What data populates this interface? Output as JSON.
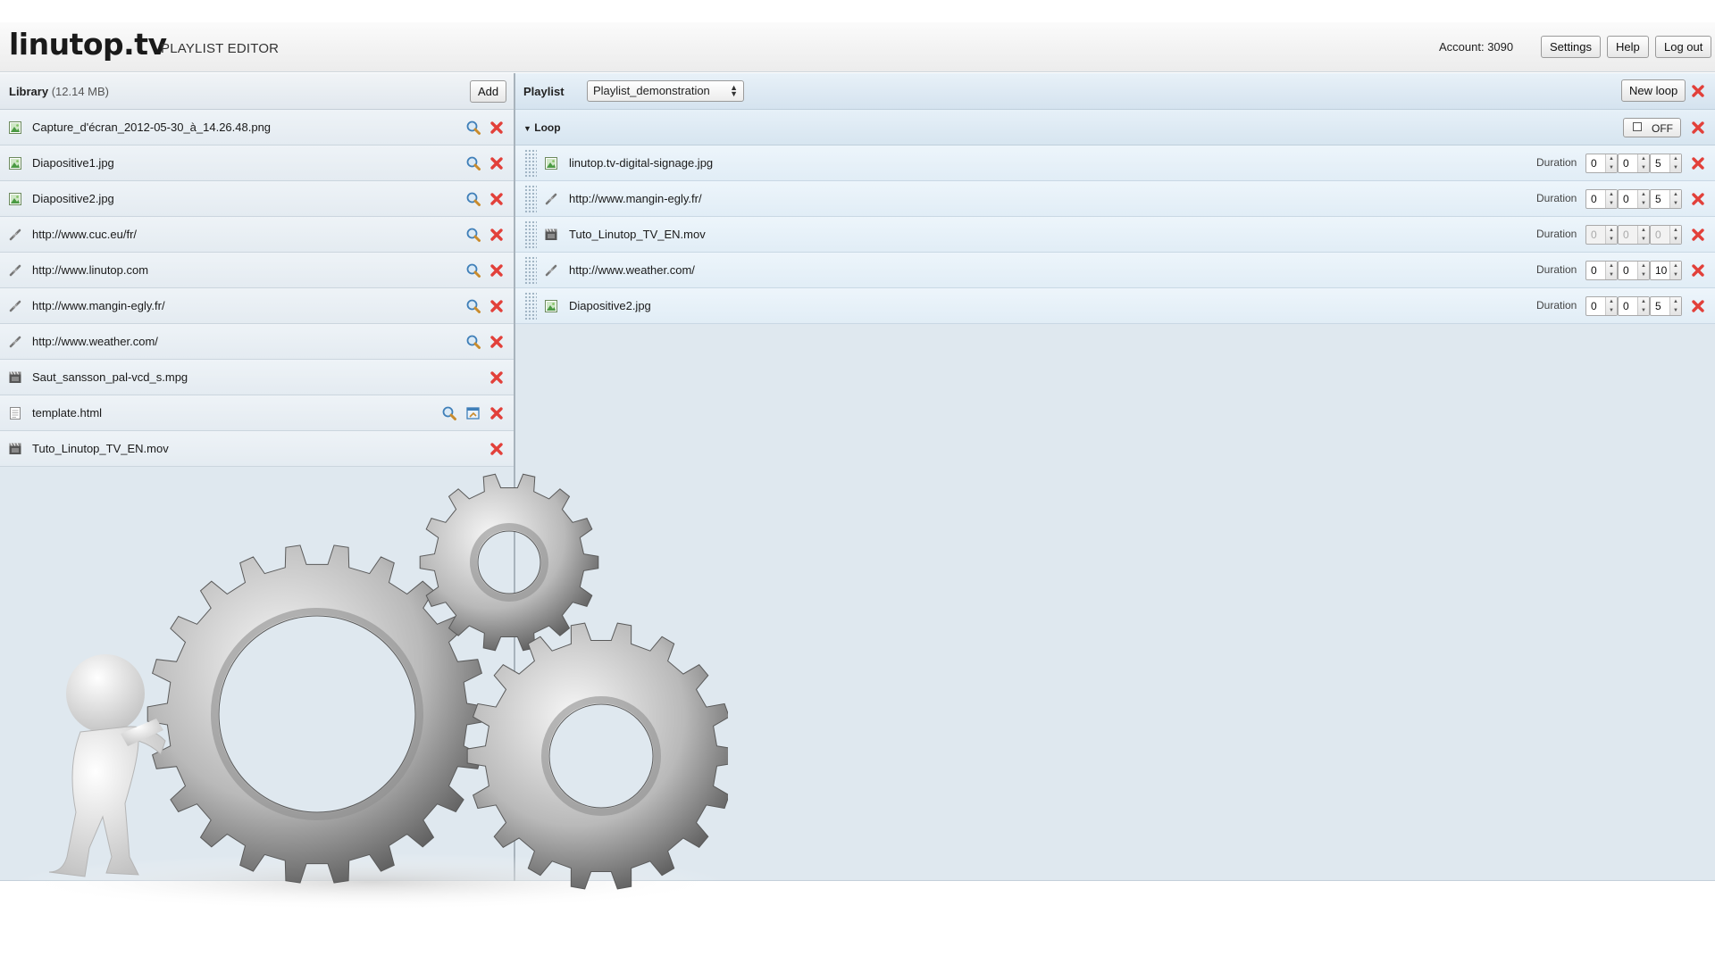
{
  "header": {
    "logo": "linutop.tv",
    "app_title": "PLAYLIST EDITOR",
    "account": "Account: 3090",
    "settings_label": "Settings",
    "help_label": "Help",
    "logout_label": "Log out"
  },
  "library": {
    "title": "Library",
    "size": "(12.14 MB)",
    "add_label": "Add",
    "items": [
      {
        "name": "Capture_d'écran_2012-05-30_à_14.26.48.png",
        "type": "image-icon"
      },
      {
        "name": "Diapositive1.jpg",
        "type": "image-icon"
      },
      {
        "name": "Diapositive2.jpg",
        "type": "image-icon"
      },
      {
        "name": "http://www.cuc.eu/fr/",
        "type": "link-icon"
      },
      {
        "name": "http://www.linutop.com",
        "type": "link-icon"
      },
      {
        "name": "http://www.mangin-egly.fr/",
        "type": "link-icon"
      },
      {
        "name": "http://www.weather.com/",
        "type": "link-icon"
      },
      {
        "name": "Saut_sansson_pal-vcd_s.mpg",
        "type": "video-icon"
      },
      {
        "name": "template.html",
        "type": "html-icon"
      },
      {
        "name": "Tuto_Linutop_TV_EN.mov",
        "type": "video-icon"
      }
    ]
  },
  "playlist": {
    "title": "Playlist",
    "selected": "Playlist_demonstration",
    "new_loop_label": "New loop",
    "loop": {
      "title": "Loop",
      "toggle_label": "OFF",
      "duration_label": "Duration",
      "items": [
        {
          "name": "linutop.tv-digital-signage.jpg",
          "type": "image-icon",
          "h": "0",
          "m": "0",
          "s": "5"
        },
        {
          "name": "http://www.mangin-egly.fr/",
          "type": "link-icon",
          "h": "0",
          "m": "0",
          "s": "5"
        },
        {
          "name": "Tuto_Linutop_TV_EN.mov",
          "type": "video-icon",
          "h": "0",
          "m": "0",
          "s": "0"
        },
        {
          "name": "http://www.weather.com/",
          "type": "link-icon",
          "h": "0",
          "m": "0",
          "s": "10"
        },
        {
          "name": "Diapositive2.jpg",
          "type": "image-icon",
          "h": "0",
          "m": "0",
          "s": "5"
        }
      ]
    }
  },
  "colors": {
    "accent_red": "#e2403a",
    "magnifier_blue": "#3f7fb8",
    "panel_bg": "#dfe8ef"
  }
}
